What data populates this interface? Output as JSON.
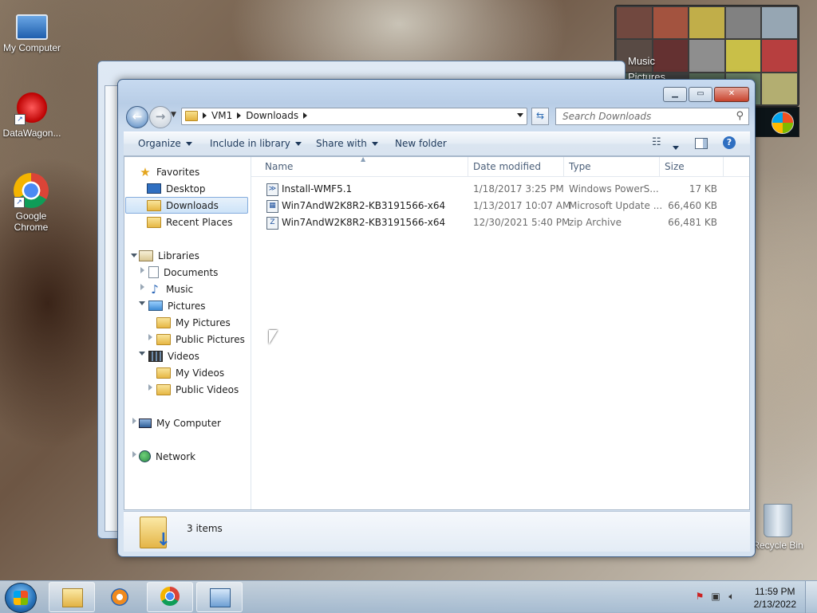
{
  "desktop": {
    "icons": [
      {
        "label": "My Computer"
      },
      {
        "label": "DataWagon..."
      },
      {
        "label": "Google Chrome"
      },
      {
        "label": "Recycle Bin"
      }
    ]
  },
  "gadget": {
    "labels": [
      "Music",
      "Pictures"
    ]
  },
  "explorer": {
    "breadcrumbs": [
      "VM1",
      "Downloads"
    ],
    "search_placeholder": "Search Downloads",
    "toolbar": {
      "organize": "Organize",
      "include_in_library": "Include in library",
      "share_with": "Share with",
      "new_folder": "New folder"
    },
    "nav": {
      "favorites": "Favorites",
      "desktop": "Desktop",
      "downloads": "Downloads",
      "recent_places": "Recent Places",
      "libraries": "Libraries",
      "documents": "Documents",
      "music": "Music",
      "pictures": "Pictures",
      "my_pictures": "My Pictures",
      "public_pictures": "Public Pictures",
      "videos": "Videos",
      "my_videos": "My Videos",
      "public_videos": "Public Videos",
      "my_computer": "My Computer",
      "network": "Network"
    },
    "columns": {
      "name": "Name",
      "date_modified": "Date modified",
      "type": "Type",
      "size": "Size"
    },
    "files": [
      {
        "name": "Install-WMF5.1",
        "date": "1/18/2017 3:25 PM",
        "type": "Windows PowerS...",
        "size": "17 KB"
      },
      {
        "name": "Win7AndW2K8R2-KB3191566-x64",
        "date": "1/13/2017 10:07 AM",
        "type": "Microsoft Update ...",
        "size": "66,460 KB"
      },
      {
        "name": "Win7AndW2K8R2-KB3191566-x64",
        "date": "12/30/2021 5:40 PM",
        "type": "zip Archive",
        "size": "66,481 KB"
      }
    ],
    "details": {
      "item_count": "3 items"
    }
  },
  "taskbar": {
    "time": "11:59 PM",
    "date": "2/13/2022"
  }
}
